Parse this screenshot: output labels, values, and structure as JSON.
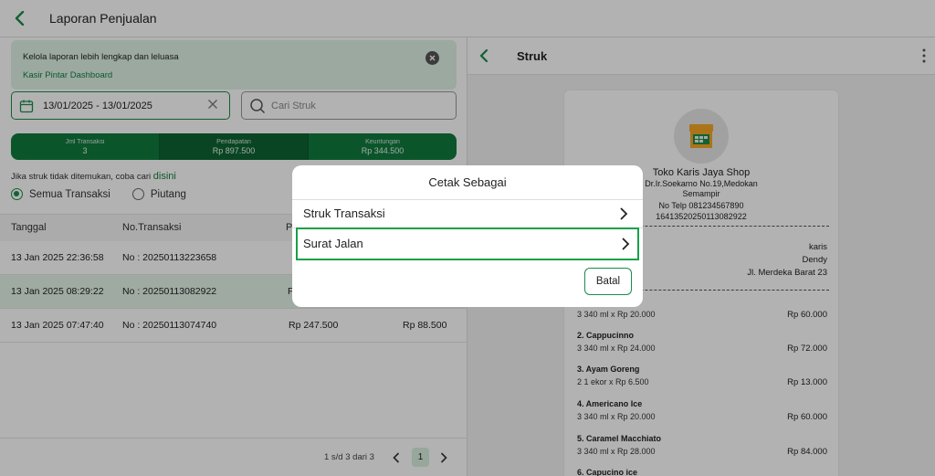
{
  "header": {
    "title": "Laporan Penjualan"
  },
  "banner": {
    "text": "Kelola laporan lebih lengkap dan leluasa",
    "link": "Kasir Pintar Dashboard"
  },
  "filters": {
    "date_range": "13/01/2025 - 13/01/2025",
    "search_placeholder": "Cari Struk"
  },
  "stats": [
    {
      "label": "Jml Transaksi",
      "value": "3"
    },
    {
      "label": "Pendapatan",
      "value": "Rp 897.500"
    },
    {
      "label": "Keuntungan",
      "value": "Rp 344.500"
    }
  ],
  "hint": {
    "text": "Jika struk tidak ditemukan, coba cari",
    "link": "disini"
  },
  "radios": [
    {
      "label": "Semua Transaksi",
      "selected": true
    },
    {
      "label": "Piutang",
      "selected": false
    }
  ],
  "table": {
    "headers": [
      "Tanggal",
      "No.Transaksi",
      "P"
    ],
    "rows": [
      {
        "date": "13 Jan 2025 22:36:58",
        "no": "No : 20250113223658",
        "amount": "",
        "profit": ""
      },
      {
        "date": "13 Jan 2025 08:29:22",
        "no": "No : 20250113082922",
        "amount": "P",
        "profit": ""
      },
      {
        "date": "13 Jan 2025 07:47:40",
        "no": "No : 20250113074740",
        "amount": "Rp 247.500",
        "profit": "Rp 88.500"
      }
    ]
  },
  "pagination": {
    "info": "1 s/d 3 dari 3",
    "current": "1"
  },
  "receipt": {
    "title": "Struk",
    "shop_name": "Toko Karis Jaya Shop",
    "address1": "Dr.Ir.Soekarno No.19,Medokan",
    "address2": "Semampir",
    "phone": "No Telp 081234567890",
    "code": "1641352025011308292​2",
    "info": [
      "karis",
      "Dendy",
      "Jl. Merdeka Barat 23"
    ],
    "items": [
      {
        "name": "",
        "qty": "3 340 ml x Rp 20.000",
        "price": "Rp 60.000"
      },
      {
        "name": "2. Cappucinno",
        "qty": "3 340 ml x Rp 24.000",
        "price": "Rp 72.000"
      },
      {
        "name": "3. Ayam Goreng",
        "qty": "2 1 ekor x Rp 6.500",
        "price": "Rp 13.000"
      },
      {
        "name": "4. Americano Ice",
        "qty": "3 340 ml x Rp 20.000",
        "price": "Rp 60.000"
      },
      {
        "name": "5. Caramel Macchiato",
        "qty": "3 340 ml x Rp 28.000",
        "price": "Rp 84.000"
      },
      {
        "name": "6. Capucino ice",
        "qty": "",
        "price": ""
      }
    ]
  },
  "dialog": {
    "title": "Cetak Sebagai",
    "options": [
      "Struk Transaksi",
      "Surat Jalan"
    ],
    "cancel": "Batal"
  },
  "colors": {
    "primary": "#1b8c4a",
    "stat_bar": "#107a3e",
    "banner_bg": "#dff3e6",
    "highlight": "#18a04a"
  }
}
